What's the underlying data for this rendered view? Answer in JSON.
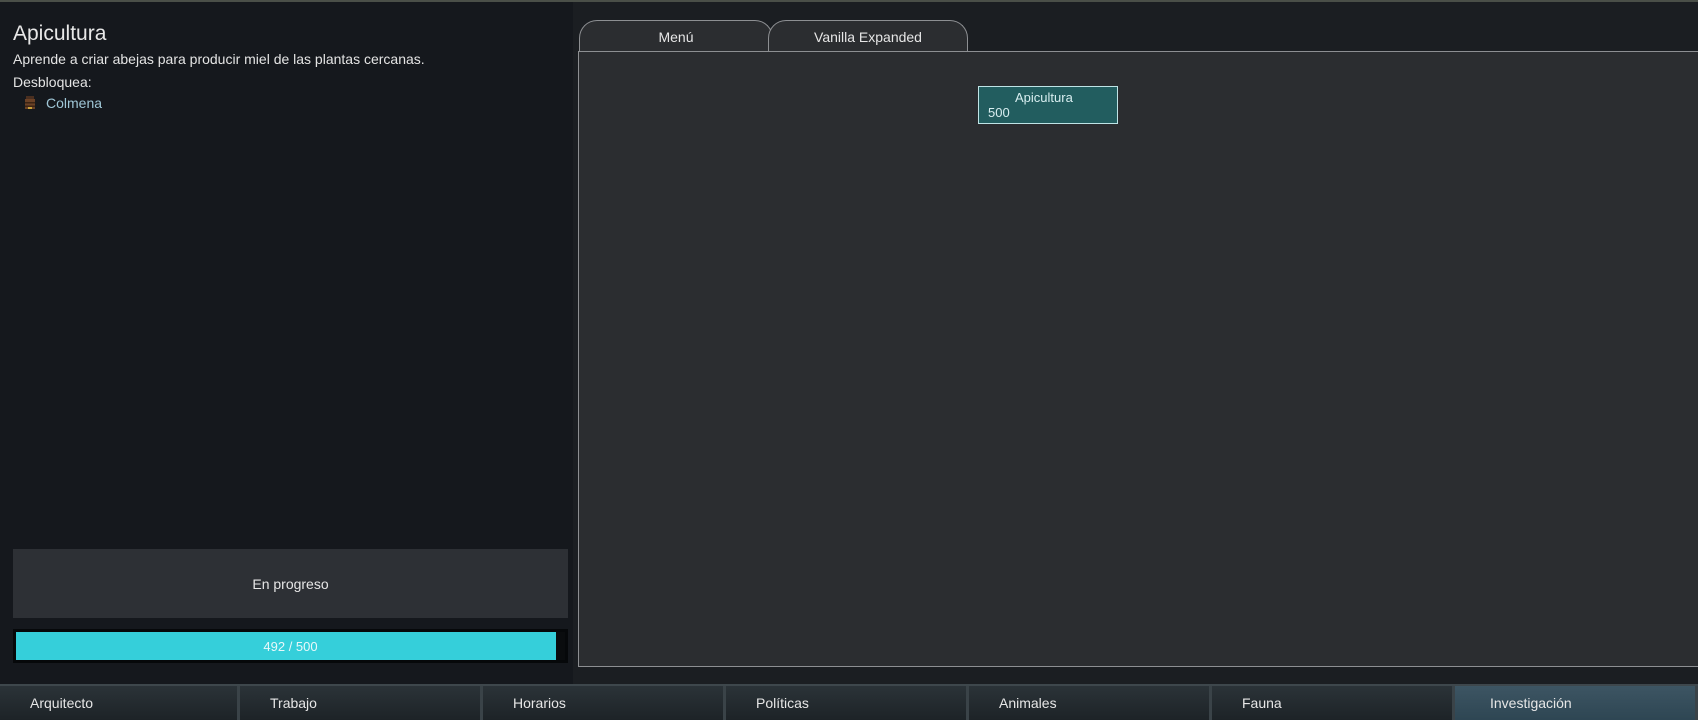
{
  "research": {
    "title": "Apicultura",
    "description": "Aprende a criar abejas para producir miel de las plantas cercanas.",
    "unlocks_label": "Desbloquea:",
    "unlocks": [
      {
        "label": "Colmena",
        "icon": "beehive-icon"
      }
    ],
    "status": "En progreso",
    "progress": {
      "current": 492,
      "total": 500,
      "text": "492 / 500"
    }
  },
  "tabs": [
    {
      "label": "Menú",
      "selected": false
    },
    {
      "label": "Vanilla Expanded",
      "selected": true
    }
  ],
  "tree": {
    "nodes": [
      {
        "name": "Apicultura",
        "cost": "500"
      }
    ]
  },
  "bottom_bar": {
    "items": [
      {
        "label": "Arquitecto",
        "active": false
      },
      {
        "label": "Trabajo",
        "active": false
      },
      {
        "label": "Horarios",
        "active": false
      },
      {
        "label": "Políticas",
        "active": false
      },
      {
        "label": "Animales",
        "active": false
      },
      {
        "label": "Fauna",
        "active": false
      },
      {
        "label": "Investigación",
        "active": true
      }
    ]
  },
  "colors": {
    "progress_fill": "#35cfda",
    "node_bg": "#225d5f",
    "link_text": "#9fc6d6"
  }
}
